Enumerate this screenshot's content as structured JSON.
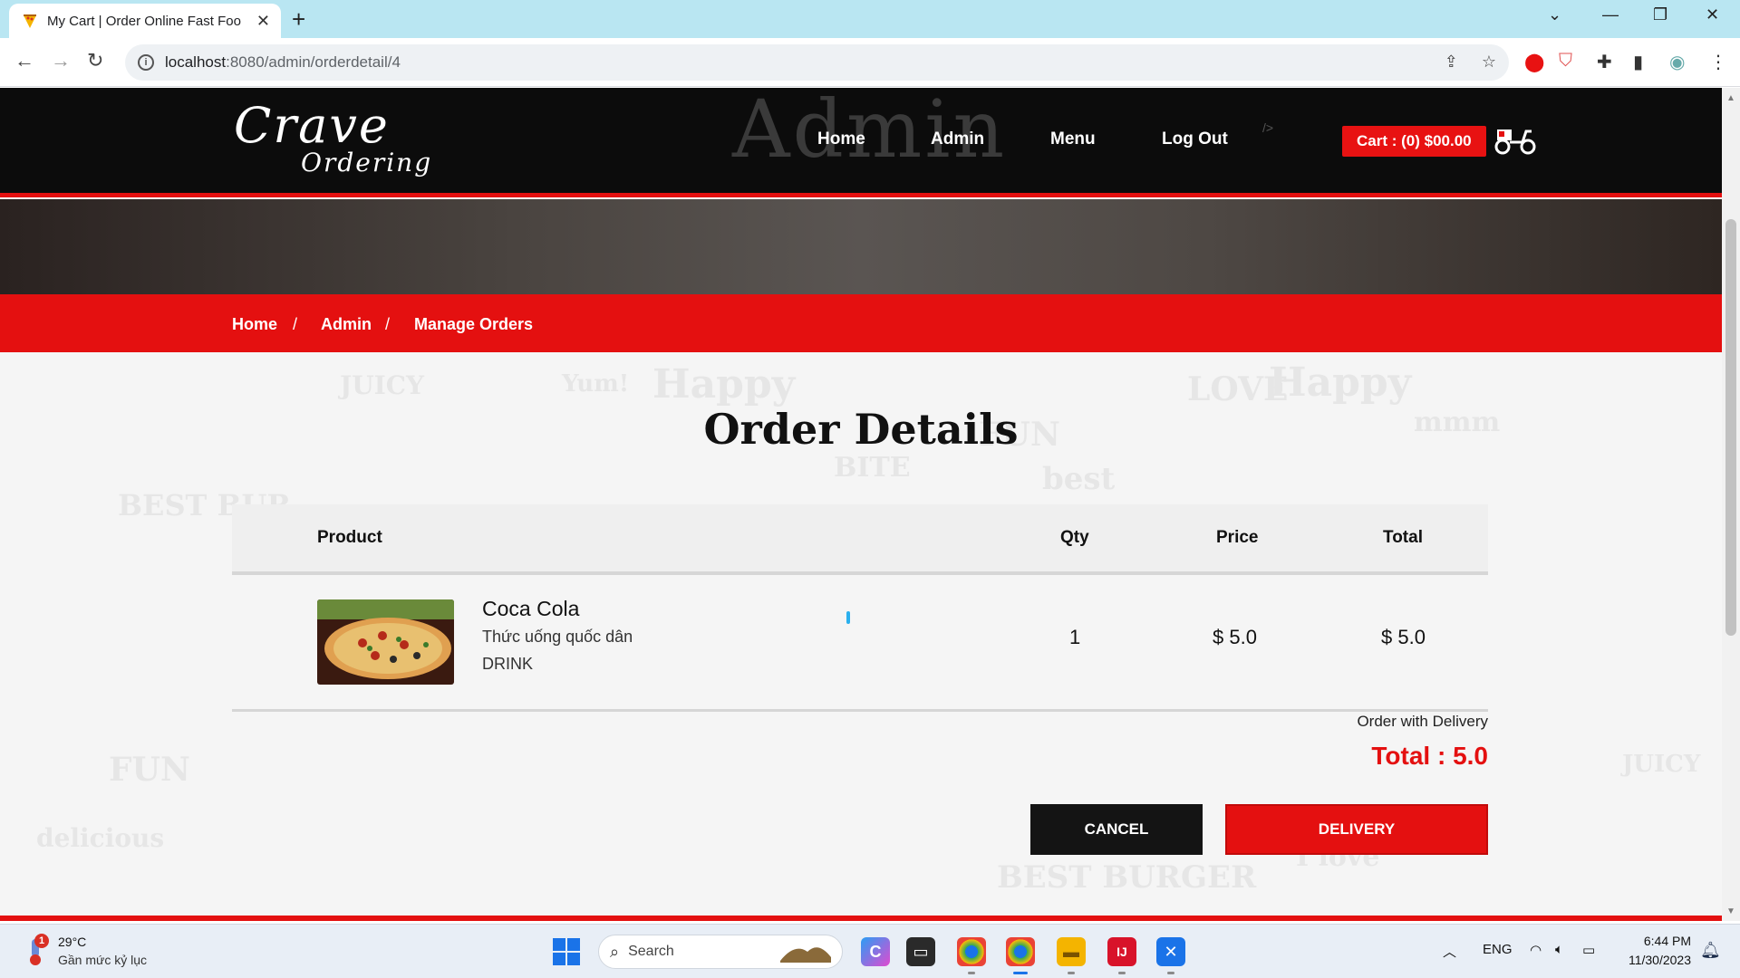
{
  "browser": {
    "tab_title": "My Cart | Order Online Fast Foo",
    "url_host": "localhost",
    "url_path": ":8080/admin/orderdetail/4"
  },
  "site": {
    "logo_line1": "Crave",
    "logo_line2": "Ordering",
    "watermark": "Admin",
    "nav": [
      "Home",
      "Admin",
      "Menu",
      "Log Out"
    ],
    "stray_tag": "/>",
    "cart_label": "Cart : (0) $00.00"
  },
  "breadcrumb": {
    "items": [
      "Home",
      "Admin",
      "Manage Orders"
    ],
    "separator": "/"
  },
  "doodles": [
    "Happy",
    "JUICY",
    "Yum!",
    "LOVE",
    "Happy",
    "BEST BUR",
    "FUN",
    "best",
    "BITE",
    "mmm",
    "FUN",
    "delicious",
    "JUICY",
    "BEST BURGER",
    "I love"
  ],
  "page": {
    "title": "Order Details"
  },
  "table": {
    "headers": {
      "product": "Product",
      "qty": "Qty",
      "price": "Price",
      "total": "Total"
    },
    "rows": [
      {
        "name": "Coca Cola",
        "description": "Thức uống quốc dân",
        "category": "DRINK",
        "qty": "1",
        "price": "$ 5.0",
        "total": "$ 5.0"
      }
    ]
  },
  "summary": {
    "delivery_note": "Order with Delivery",
    "total": "Total : 5.0"
  },
  "actions": {
    "cancel": "CANCEL",
    "delivery": "DELIVERY"
  },
  "taskbar": {
    "weather_temp": "29°C",
    "weather_desc": "Gần mức kỷ lục",
    "weather_badge": "1",
    "search_label": "Search",
    "language": "ENG",
    "time": "6:44 PM",
    "date": "11/30/2023"
  },
  "colors": {
    "accent_red": "#e41010",
    "header_black": "#0c0c0c",
    "button_dark": "#141414"
  }
}
